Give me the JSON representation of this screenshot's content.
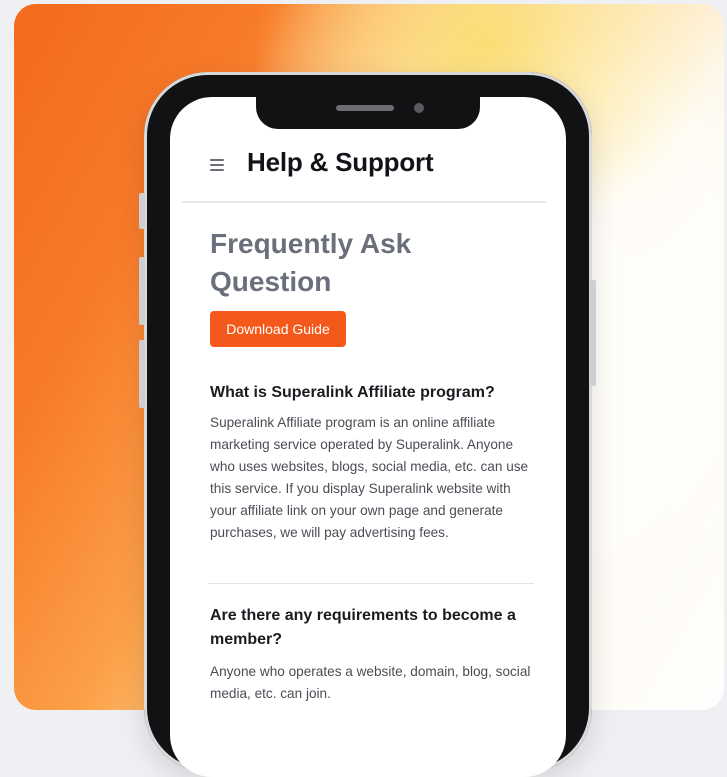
{
  "header": {
    "title": "Help & Support"
  },
  "page": {
    "title": "Frequently Ask Question",
    "download_label": "Download Guide"
  },
  "faq": [
    {
      "question": "What is Superalink Affiliate program?",
      "answer": "Superalink Affiliate program is an online affiliate marketing service operated by Superalink. Anyone who uses websites, blogs, social media, etc. can use this service. If you display Superalink website with your affiliate link on your own page and generate purchases, we will pay advertising fees."
    },
    {
      "question": "Are there any requirements to become a member?",
      "answer": "Anyone who operates a website, domain, blog, social media, etc. can join."
    }
  ],
  "icons": {
    "menu": "hamburger-menu-icon"
  },
  "colors": {
    "accent": "#f4581a",
    "title": "#6a6f7b"
  }
}
